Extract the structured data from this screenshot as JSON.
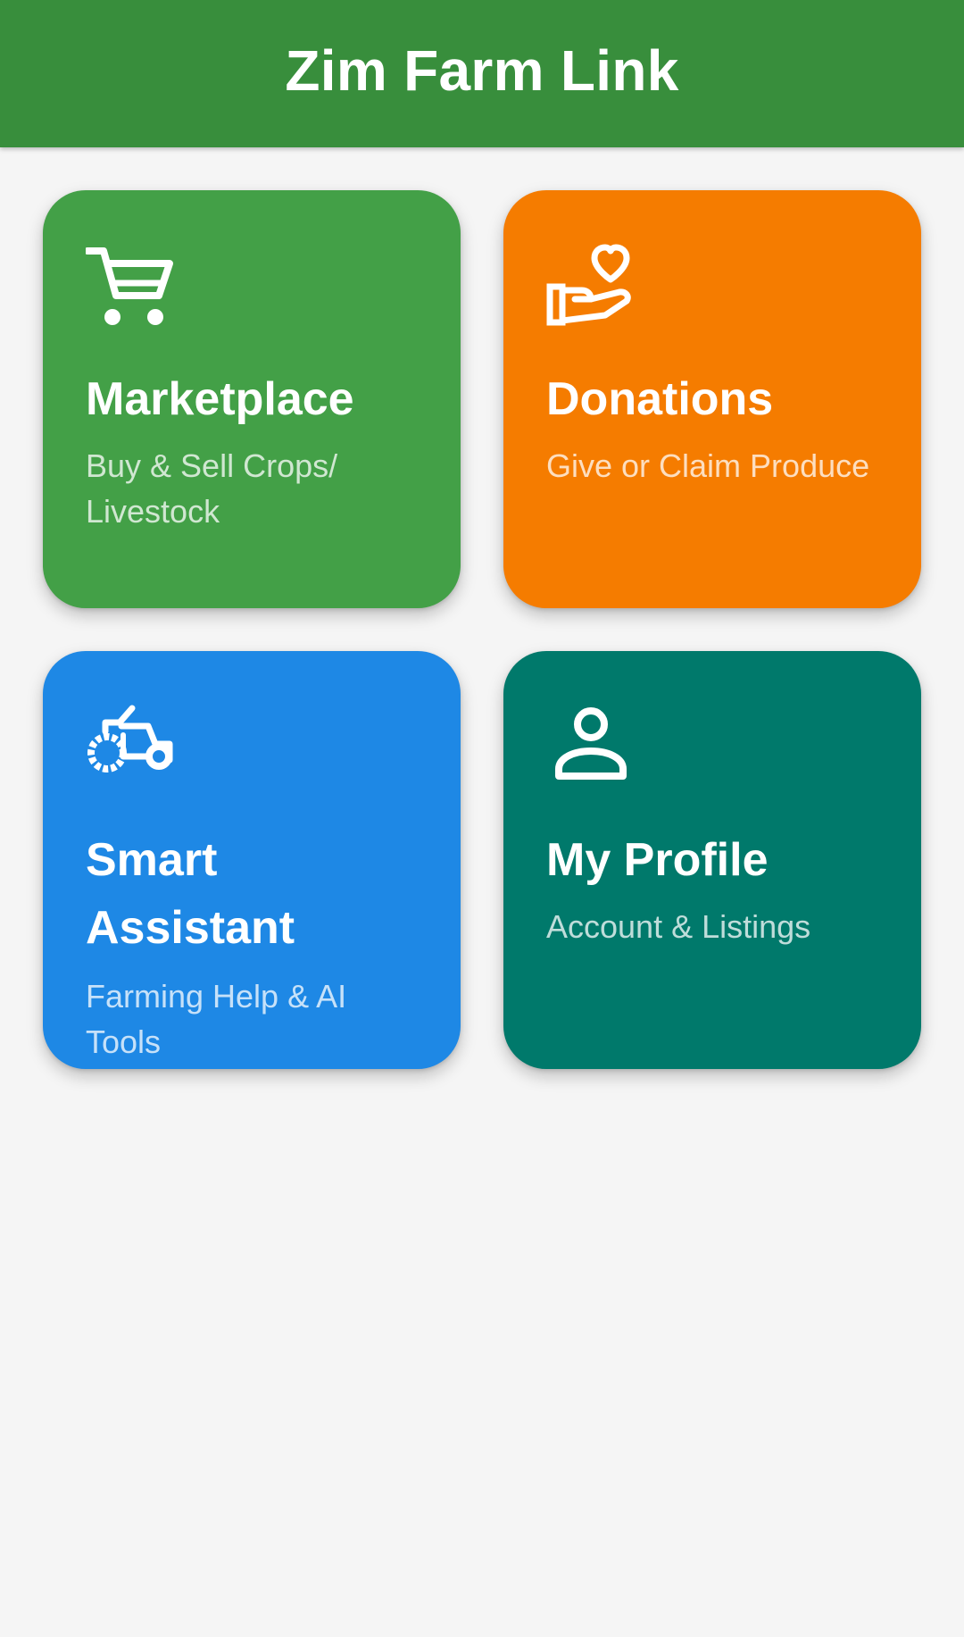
{
  "app_bar": {
    "title": "Zim Farm Link",
    "color": "#388e3c"
  },
  "cards": [
    {
      "title": "Marketplace",
      "subtitle": "Buy & Sell Crops/ Livestock",
      "icon": "shopping-cart-icon",
      "color": "#43a047"
    },
    {
      "title": "Donations",
      "subtitle": "Give or Claim Produce",
      "icon": "hand-heart-icon",
      "color": "#f57c00"
    },
    {
      "title": "Smart Assistant",
      "subtitle": "Farming Help & AI Tools",
      "icon": "tractor-icon",
      "color": "#1e88e5"
    },
    {
      "title": "My Profile",
      "subtitle": "Account & Listings",
      "icon": "person-icon",
      "color": "#00796b"
    }
  ],
  "background": "#f5f5f5"
}
